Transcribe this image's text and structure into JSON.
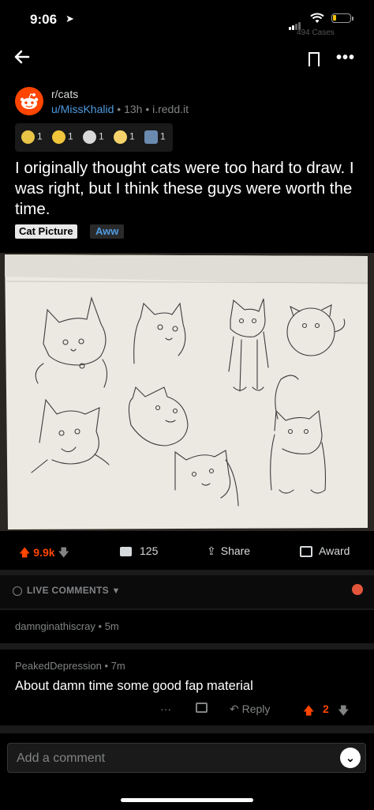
{
  "status_bar": {
    "time": "9:06",
    "location_glyph": "➤",
    "faint_text": "494 Cases"
  },
  "post": {
    "subreddit": "r/cats",
    "author": "u/MissKhalid",
    "age": "13h",
    "domain": "i.redd.it",
    "separator": "•",
    "awards": [
      {
        "icon": "silver-award-icon",
        "count": "1",
        "color": "#e8c547"
      },
      {
        "icon": "gold-award-icon",
        "count": "1",
        "color": "#f0c53c"
      },
      {
        "icon": "wholesome-award-icon",
        "count": "1",
        "color": "#d8d8d8"
      },
      {
        "icon": "rocket-like-award-icon",
        "count": "1",
        "color": "#f5d36a"
      },
      {
        "icon": "helpful-award-icon",
        "count": "1",
        "color": "#6a8ab0"
      }
    ],
    "title": "I originally thought cats were too hard to draw. I was right, but I think these guys were worth the time.",
    "flair_primary": "Cat Picture",
    "flair_secondary": "Aww"
  },
  "actions": {
    "score": "9.9k",
    "comments": "125",
    "share": "Share",
    "award": "Award"
  },
  "live_comments": {
    "label": "LIVE COMMENTS"
  },
  "comments": [
    {
      "author": "damnginathiscray",
      "age": "5m"
    },
    {
      "author": "PeakedDepression",
      "age": "7m",
      "body": "About damn time some good fap material",
      "reply": "Reply",
      "score": "2",
      "more": "···"
    }
  ],
  "comment_input": {
    "placeholder": "Add a comment"
  },
  "colors": {
    "accent": "#ff4500",
    "link": "#4f9be0",
    "background": "#000000",
    "surface": "#1a1a1b"
  }
}
